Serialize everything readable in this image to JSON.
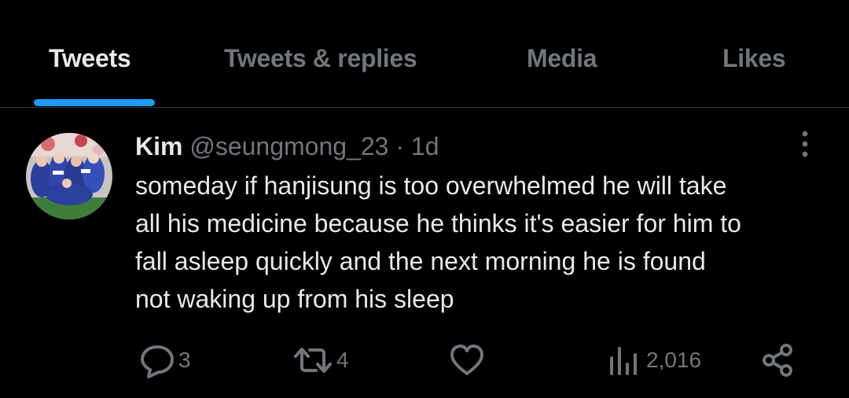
{
  "tabs": [
    {
      "label": "Tweets",
      "active": true
    },
    {
      "label": "Tweets & replies",
      "active": false
    },
    {
      "label": "Media",
      "active": false
    },
    {
      "label": "Likes",
      "active": false
    }
  ],
  "tweet": {
    "name": "Kim",
    "handle": "@seungmong_23",
    "separator": "·",
    "time": "1d",
    "text_lines": [
      "someday if hanjisung is too overwhelmed he will take",
      "all his medicine because he thinks it's easier for him to",
      "fall asleep quickly and the next morning he is found",
      "not waking up from his sleep"
    ],
    "actions": {
      "reply_count": "3",
      "retweet_count": "4",
      "views_count": "2,016"
    }
  },
  "icons": {
    "reply": "reply-bubble-icon",
    "retweet": "retweet-icon",
    "like": "heart-icon",
    "views": "views-bar-chart-icon",
    "share": "share-icon",
    "more": "more-vertical-icon"
  },
  "colors": {
    "background": "#000000",
    "primary_text": "#e7e9ea",
    "secondary_text": "#71767b",
    "accent": "#1d9bf0",
    "divider": "#2f3336"
  }
}
